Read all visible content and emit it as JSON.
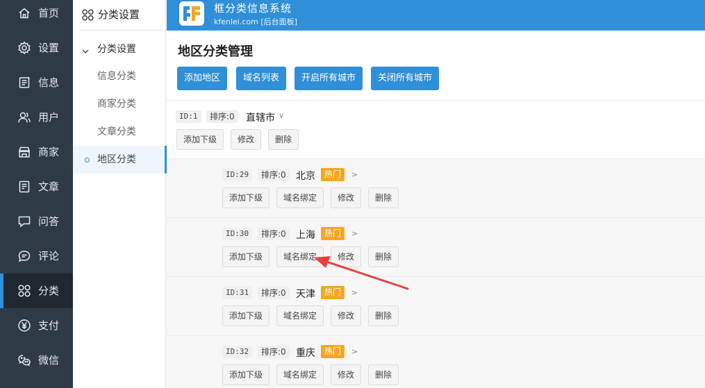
{
  "nav": [
    {
      "label": "首页",
      "icon": "home-icon"
    },
    {
      "label": "设置",
      "icon": "gear-icon"
    },
    {
      "label": "信息",
      "icon": "document-icon"
    },
    {
      "label": "用户",
      "icon": "users-icon"
    },
    {
      "label": "商家",
      "icon": "store-icon"
    },
    {
      "label": "文章",
      "icon": "article-icon"
    },
    {
      "label": "问答",
      "icon": "chat-icon"
    },
    {
      "label": "评论",
      "icon": "comment-icon"
    },
    {
      "label": "分类",
      "icon": "category-icon",
      "active": true
    },
    {
      "label": "支付",
      "icon": "yen-icon"
    },
    {
      "label": "微信",
      "icon": "wechat-icon"
    }
  ],
  "subnav": {
    "title": "分类设置",
    "group": "分类设置",
    "items": [
      "信息分类",
      "商家分类",
      "文章分类",
      "地区分类"
    ],
    "active": "地区分类"
  },
  "header": {
    "title": "框分类信息系统",
    "subtitle": "kfenlei.com [后台面板]"
  },
  "main": {
    "title": "地区分类管理",
    "toolbar": [
      "添加地区",
      "域名列表",
      "开启所有城市",
      "关闭所有城市"
    ],
    "root": {
      "id": "ID:1",
      "order": "排序:0",
      "name": "直辖市",
      "caret": "∨",
      "actions": [
        "添加下级",
        "修改",
        "删除"
      ]
    },
    "children": [
      {
        "id": "ID:29",
        "order": "排序:0",
        "name": "北京",
        "badge": "热门",
        "caret": ">"
      },
      {
        "id": "ID:30",
        "order": "排序:0",
        "name": "上海",
        "badge": "热门",
        "caret": ">"
      },
      {
        "id": "ID:31",
        "order": "排序:0",
        "name": "天津",
        "badge": "热门",
        "caret": ">"
      },
      {
        "id": "ID:32",
        "order": "排序:0",
        "name": "重庆",
        "badge": "热门",
        "caret": ">"
      }
    ],
    "child_actions": [
      "添加下级",
      "域名绑定",
      "修改",
      "删除"
    ]
  },
  "colors": {
    "nav_bg": "#2f3a47",
    "accent": "#2f8fd8",
    "hot": "#f5a623",
    "annotation": "#e84040"
  }
}
